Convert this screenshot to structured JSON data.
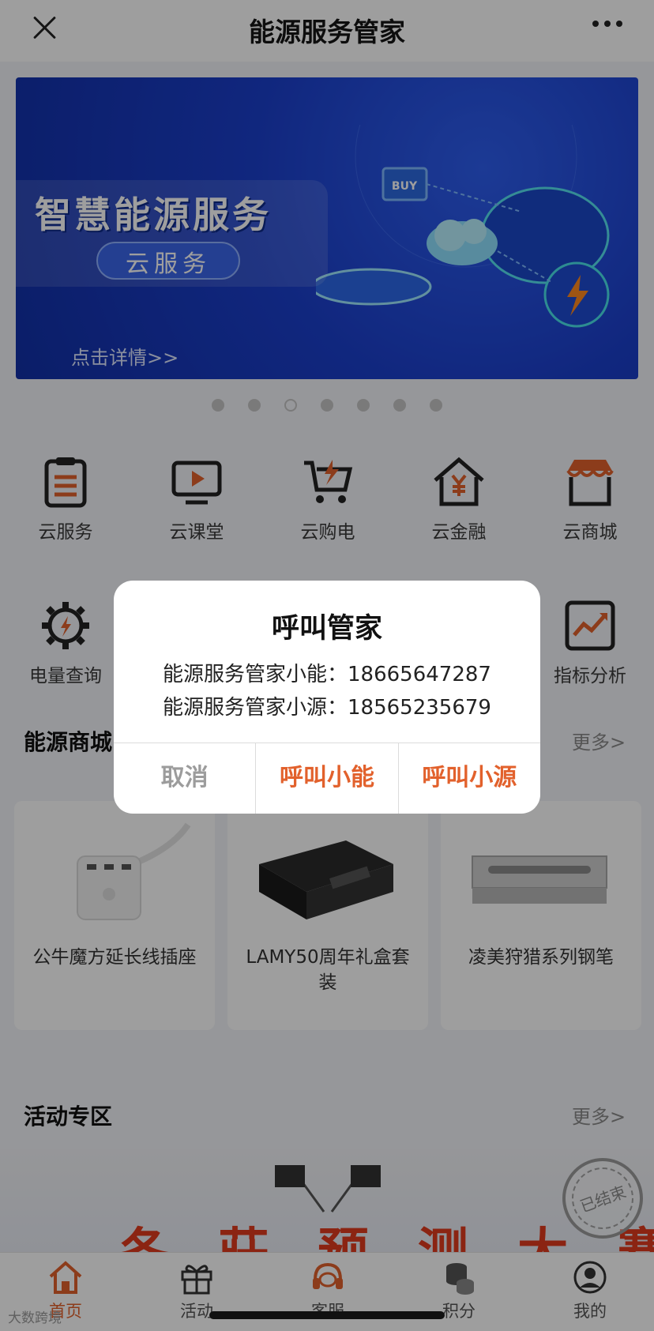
{
  "header": {
    "title": "能源服务管家"
  },
  "banner": {
    "title": "智慧能源服务",
    "subtitle": "云服务",
    "link": "点击详情>>",
    "badge_text": "BUY"
  },
  "carousel": {
    "count": 7,
    "active_index": 2
  },
  "services": [
    {
      "label": "云服务",
      "icon": "clipboard-icon"
    },
    {
      "label": "云课堂",
      "icon": "tv-play-icon"
    },
    {
      "label": "云购电",
      "icon": "cart-lightning-icon"
    },
    {
      "label": "云金融",
      "icon": "house-yen-icon"
    },
    {
      "label": "云商城",
      "icon": "store-icon"
    },
    {
      "label": "电量查询",
      "icon": "gear-lightning-icon"
    },
    {
      "label": "指标分析",
      "icon": "chart-trend-icon"
    }
  ],
  "mall": {
    "title": "能源商城",
    "more": "更多>",
    "products": [
      {
        "name": "公牛魔方延长线插座"
      },
      {
        "name": "LAMY50周年礼盒套装"
      },
      {
        "name": "凌美狩猎系列钢笔"
      }
    ]
  },
  "activity": {
    "title": "活动专区",
    "more": "更多>",
    "banner_text": "冬 莊 预 测 大 赛",
    "stamp": "已结束"
  },
  "tabbar": {
    "items": [
      {
        "label": "首页",
        "icon": "home-icon"
      },
      {
        "label": "活动",
        "icon": "gift-icon"
      },
      {
        "label": "客服",
        "icon": "headset-icon"
      },
      {
        "label": "积分",
        "icon": "coins-icon"
      },
      {
        "label": "我的",
        "icon": "user-icon"
      }
    ]
  },
  "watermark": "大数跨境",
  "dialog": {
    "title": "呼叫管家",
    "lines": [
      "能源服务管家小能：18665647287",
      "能源服务管家小源：18565235679"
    ],
    "buttons": [
      "取消",
      "呼叫小能",
      "呼叫小源"
    ]
  },
  "colors": {
    "accent": "#e2612c",
    "banner_blue": "#1b3fcc",
    "overlay": "rgba(0,0,0,0.38)"
  }
}
